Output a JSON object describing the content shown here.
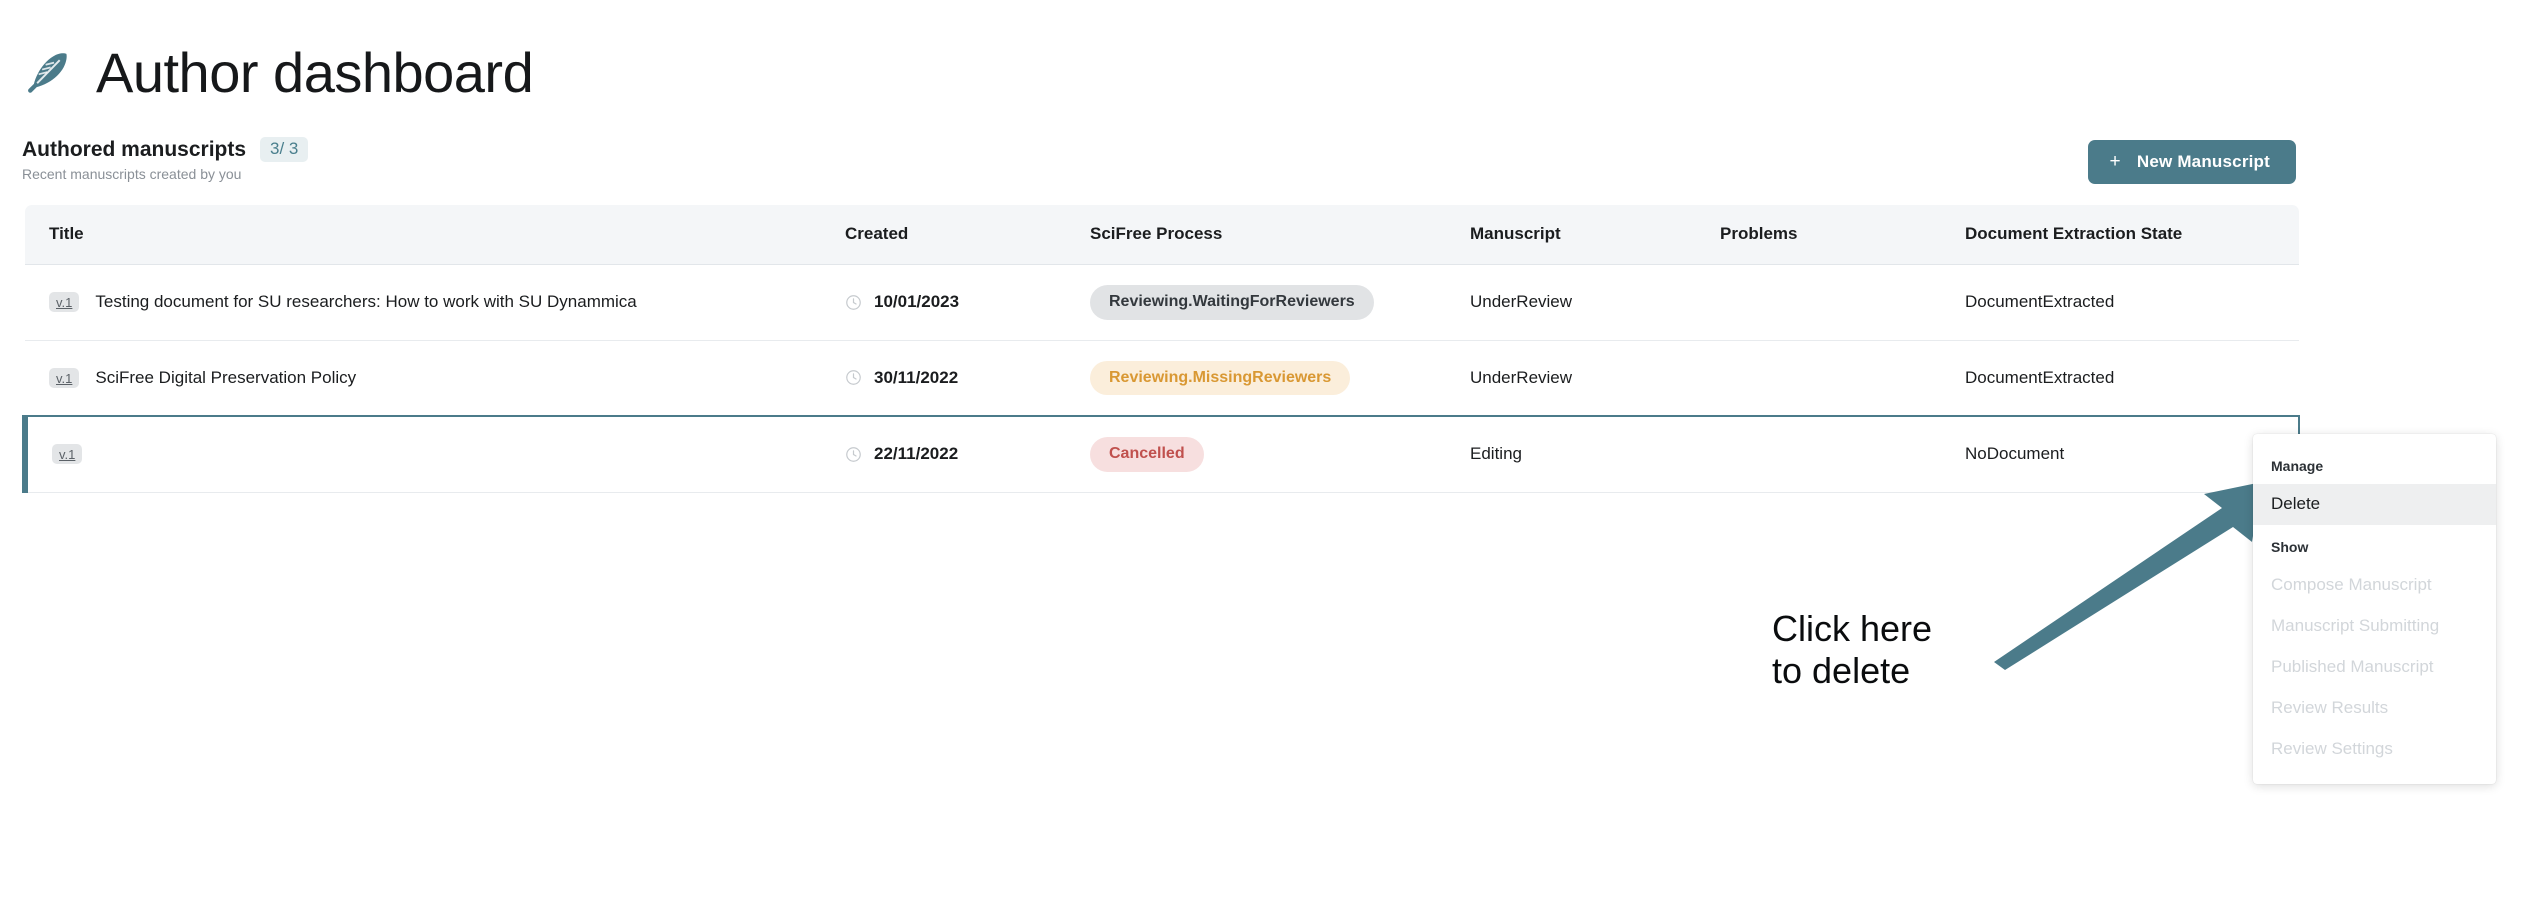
{
  "header": {
    "title": "Author dashboard",
    "icon": "feather-icon"
  },
  "section": {
    "title": "Authored manuscripts",
    "count_badge": "3/ 3",
    "subtitle": "Recent manuscripts created by you",
    "new_button_label": "New Manuscript",
    "new_button_plus": "+"
  },
  "table": {
    "columns": [
      "Title",
      "Created",
      "SciFree Process",
      "Manuscript",
      "Problems",
      "Document Extraction State"
    ],
    "rows": [
      {
        "version": "v.1",
        "title": "Testing document for SU researchers: How to work with SU Dynammica",
        "created": "10/01/2023",
        "process": "Reviewing.WaitingForReviewers",
        "process_style": "gray",
        "manuscript": "UnderReview",
        "problems": "",
        "doc_state": "DocumentExtracted",
        "selected": false
      },
      {
        "version": "v.1",
        "title": "SciFree Digital Preservation Policy",
        "created": "30/11/2022",
        "process": "Reviewing.MissingReviewers",
        "process_style": "orange",
        "manuscript": "UnderReview",
        "problems": "",
        "doc_state": "DocumentExtracted",
        "selected": false
      },
      {
        "version": "v.1",
        "title": "",
        "created": "22/11/2022",
        "process": "Cancelled",
        "process_style": "red",
        "manuscript": "Editing",
        "problems": "",
        "doc_state": "NoDocument",
        "selected": true
      }
    ]
  },
  "context_menu": {
    "groups": [
      {
        "label": "Manage",
        "items": [
          {
            "label": "Delete",
            "state": "highlight"
          }
        ]
      },
      {
        "label": "Show",
        "items": [
          {
            "label": "Compose Manuscript",
            "state": "disabled"
          },
          {
            "label": "Manuscript Submitting",
            "state": "disabled"
          },
          {
            "label": "Published Manuscript",
            "state": "disabled"
          },
          {
            "label": "Review Results",
            "state": "disabled"
          },
          {
            "label": "Review Settings",
            "state": "disabled"
          }
        ]
      }
    ]
  },
  "annotation": {
    "text": "Click here\nto delete",
    "arrow_color": "#4b7b8a"
  },
  "colors": {
    "accent": "#4b7b8a",
    "badge_bg": "#e8eff1",
    "badge_text": "#4a7f8d",
    "pill_gray_bg": "#e1e3e5",
    "pill_orange_bg": "#fbeedb",
    "pill_orange_text": "#d99833",
    "pill_red_bg": "#f7dfdf",
    "pill_red_text": "#c0504d",
    "header_bg": "#f4f6f8"
  }
}
